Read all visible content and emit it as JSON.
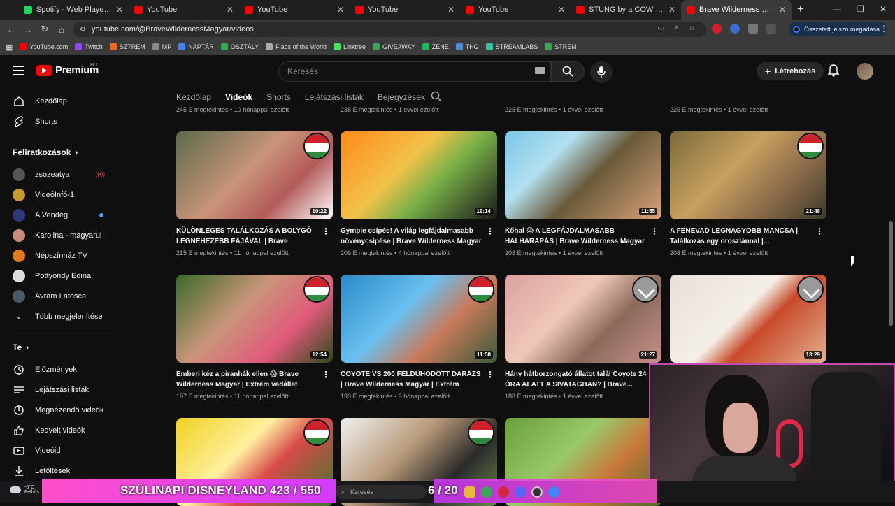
{
  "browser": {
    "tabs": [
      {
        "title": "Spotify - Web Player: Music for",
        "color": "#1ed760",
        "active": false
      },
      {
        "title": "YouTube",
        "color": "#ff0000",
        "active": false
      },
      {
        "title": "YouTube",
        "color": "#ff0000",
        "active": false
      },
      {
        "title": "YouTube",
        "color": "#ff0000",
        "active": false
      },
      {
        "title": "YouTube",
        "color": "#ff0000",
        "active": false
      },
      {
        "title": "STUNG by a COW KILLER! - You",
        "color": "#ff0000",
        "active": false
      },
      {
        "title": "Brave Wilderness Magyar - You",
        "color": "#ff0000",
        "active": true
      }
    ],
    "url": "youtube.com/@BraveWildernessMagyar/videos",
    "password_pill": "Összetett jelszó megadása",
    "bookmarks": [
      {
        "label": "YouTube.com",
        "color": "#ff0000"
      },
      {
        "label": "Twitch",
        "color": "#9146ff"
      },
      {
        "label": "SZTREM",
        "color": "#f06a1c"
      },
      {
        "label": "MP",
        "color": "#888888"
      },
      {
        "label": "NAPTÁR",
        "color": "#4285f4"
      },
      {
        "label": "OSZTÁLY",
        "color": "#34a853"
      },
      {
        "label": "Flags of the World",
        "color": "#aaaaaa"
      },
      {
        "label": "Linktree",
        "color": "#43e55e"
      },
      {
        "label": "GIVEAWAY",
        "color": "#34a853"
      },
      {
        "label": "ZENE",
        "color": "#1db954"
      },
      {
        "label": "THG",
        "color": "#4a90e2"
      },
      {
        "label": "STREAMLABS",
        "color": "#31c3a2"
      },
      {
        "label": "STREM",
        "color": "#34a853"
      }
    ]
  },
  "header": {
    "brand": "Premium",
    "country": "HU",
    "search_placeholder": "Keresés",
    "create_label": "Létrehozás"
  },
  "sidebar": {
    "top": [
      {
        "label": "Kezdőlap",
        "icon": "home-icon"
      },
      {
        "label": "Shorts",
        "icon": "shorts-icon"
      }
    ],
    "subs_heading": "Feliratkozások",
    "subscriptions": [
      {
        "label": "zsozeatya",
        "color": "#555555",
        "badge": "live"
      },
      {
        "label": "VideóInfó-1",
        "color": "#c79b2a",
        "badge": ""
      },
      {
        "label": "A Vendég",
        "color": "#2a3a7a",
        "badge": "new"
      },
      {
        "label": "Karolina - magyarul",
        "color": "#c98a7a",
        "badge": ""
      },
      {
        "label": "Népszínház TV",
        "color": "#e07a1a",
        "badge": ""
      },
      {
        "label": "Pottyondy Edina",
        "color": "#dddddd",
        "badge": ""
      },
      {
        "label": "Avram Latosca",
        "color": "#4a5a6a",
        "badge": ""
      }
    ],
    "more_label": "Több megjelenítése",
    "you_heading": "Te",
    "you_items": [
      {
        "label": "Előzmények",
        "icon": "history-icon"
      },
      {
        "label": "Lejátszási listák",
        "icon": "playlist-icon"
      },
      {
        "label": "Megnézendő videók",
        "icon": "watch-later-icon"
      },
      {
        "label": "Kedvelt videók",
        "icon": "like-icon"
      },
      {
        "label": "Videóid",
        "icon": "your-videos-icon"
      },
      {
        "label": "Letöltések",
        "icon": "download-icon"
      }
    ]
  },
  "channel_tabs": [
    "Kezdőlap",
    "Videók",
    "Shorts",
    "Lejátszási listák",
    "Bejegyzések"
  ],
  "prev_row_meta": [
    "245 E megtekintés • 10 hónappal ezelőtt",
    "238 E megtekintés • 1 évvel ezelőtt",
    "225 E megtekintés • 1 évvel ezelőtt",
    "225 E megtekintés • 1 évvel ezelőtt"
  ],
  "videos": [
    {
      "title": "KÜLÖNLEGES TALÁLKOZÁS A BOLYGÓ LEGNEHEZEBB FÁJÁVAL | Brave Wildernes...",
      "meta": "215 E megtekintés • 11 hónappal ezelőtt",
      "duration": "10:22",
      "bg": "linear-gradient(135deg,#5a6a4a,#c9957a 45%,#b35a5a 70%,#fff 100%)",
      "badge": "flag"
    },
    {
      "title": "Gympie csípés! A világ legfájdalmasabb növénycsípése | Brave Wilderness Magyar",
      "meta": "209 E megtekintés • 4 hónappal ezelőtt",
      "duration": "19:14",
      "bg": "linear-gradient(135deg,#ff8a1a,#f2c24a 40%,#7ab048 60%,#1a1a1a 100%)",
      "badge": ""
    },
    {
      "title": "Kőhal 😱 A LEGFÁJDALMASABB HALHARAPÁS | Brave Wilderness Magyar |...",
      "meta": "208 E megtekintés • 1 évvel ezelőtt",
      "duration": "11:55",
      "bg": "linear-gradient(135deg,#7ac6e8,#b3e0f0 30%,#6a5a3a 55%,#d9a27a 100%)",
      "badge": ""
    },
    {
      "title": "A FENEVAD LEGNAGYOBB MANCSA | Találkozás egy oroszlánnal |...",
      "meta": "208 E megtekintés • 1 évvel ezelőtt",
      "duration": "21:48",
      "bg": "linear-gradient(135deg,#7a6a3a,#c8a060 40%,#8a6a4a 70%,#3a3a2a 100%)",
      "badge": "flag"
    },
    {
      "title": "Emberi kéz a piranhák ellen 😱 Brave Wilderness Magyar | Extrém vadállat harapás",
      "meta": "197 E megtekintés • 11 hónappal ezelőtt",
      "duration": "12:54",
      "bg": "linear-gradient(135deg,#3a6a2a,#c9957a 40%,#e05a7a 70%,#2a4a1a 100%)",
      "badge": "flag"
    },
    {
      "title": "COYOTE VS 200 FELDÜHÖDÖTT DARÁZS | Brave Wilderness Magyar | Extrém vadállat...",
      "meta": "190 E megtekintés • 9 hónappal ezelőtt",
      "duration": "11:58",
      "bg": "linear-gradient(135deg,#2a8ac8,#6ac0f0 40%,#c97a5a 65%,#3a5a3a 100%)",
      "badge": "flag"
    },
    {
      "title": "Hány hátborzongató állatot talál Coyote 24 ÓRA ALATT A SIVATAGBAN? | Brave...",
      "meta": "188 E megtekintés • 1 évvel ezelőtt",
      "duration": "21:27",
      "bg": "linear-gradient(135deg,#d9a0a0,#f0c8b8 40%,#8a6a5a 65%,#c8908a 100%)",
      "badge": "gray"
    },
    {
      "title": "",
      "meta": "",
      "duration": "13:29",
      "bg": "linear-gradient(135deg,#e8e0d8,#f4efe8 45%,#c84a2a 60%,#e2b090 100%)",
      "badge": "gray"
    },
    {
      "title": "",
      "meta": "",
      "duration": "",
      "bg": "linear-gradient(135deg,#f0d020,#fff0a0 40%,#d84a4a 60%,#3a7a2a 100%)",
      "badge": "flag"
    },
    {
      "title": "",
      "meta": "",
      "duration": "",
      "bg": "linear-gradient(135deg,#f0f0f0,#b89a7a 40%,#2a2a2a 70%,#6a8a4a 100%)",
      "badge": "flag"
    },
    {
      "title": "",
      "meta": "",
      "duration": "",
      "bg": "linear-gradient(135deg,#6aa03a,#9ac86a 40%,#c8783a 65%,#4a6a2a 100%)",
      "badge": ""
    }
  ],
  "overlay": {
    "weather_temp": "-5°C",
    "weather_desc": "Felhős",
    "stream_title": "SZÜLINAPI DISNEYLAND",
    "stream_count": "423 / 550",
    "counter2": "6 / 20",
    "taskbar_search": "Keresés"
  }
}
